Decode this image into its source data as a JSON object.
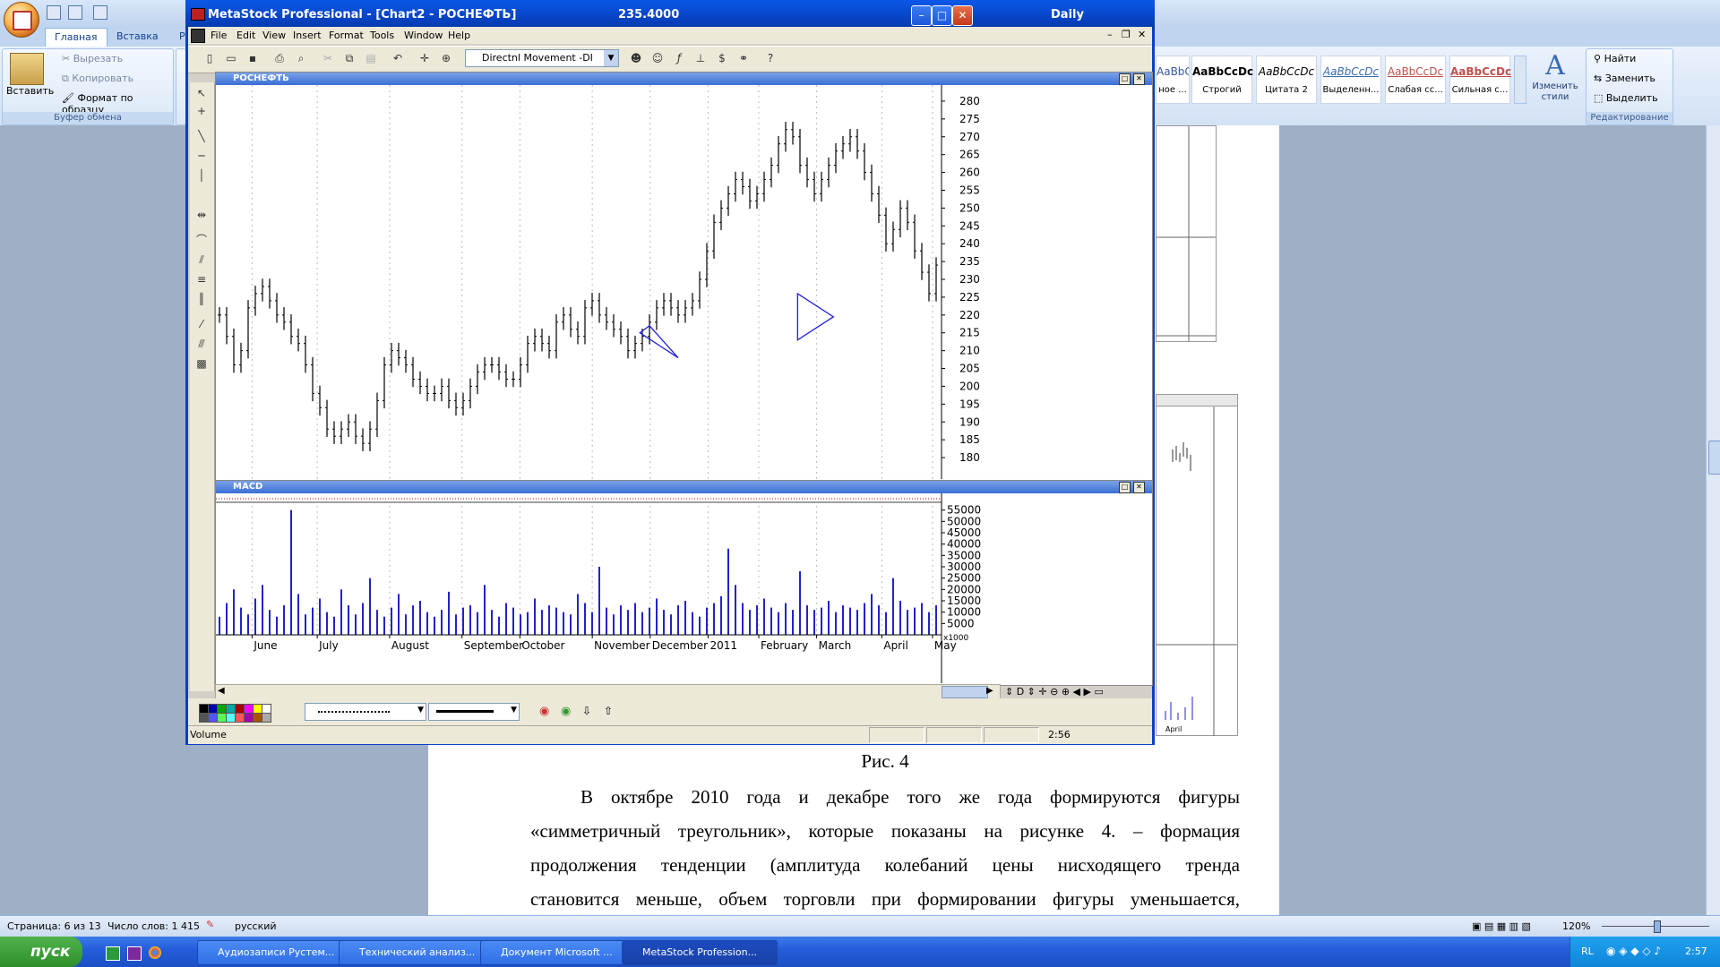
{
  "word": {
    "tabs": [
      "Главная",
      "Вставка",
      "Р"
    ],
    "clipboard": {
      "paste": "Вставить",
      "cut": "Вырезать",
      "copy": "Копировать",
      "format_painter": "Формат по образцу",
      "group_label": "Буфер обмена"
    },
    "styles": [
      {
        "sample": "AaBbCcDc",
        "name": "ное ..."
      },
      {
        "sample": "AaBbCcDc",
        "name": "Строгий"
      },
      {
        "sample": "AaBbCcDc",
        "name": "Цитата 2"
      },
      {
        "sample": "AaBbCcDc",
        "name": "Выделенн..."
      },
      {
        "sample": "AaBbCcDc",
        "name": "Слабая сс..."
      },
      {
        "sample": "AaBbCcDc",
        "name": "Сильная с..."
      }
    ],
    "change_styles": "Изменить стили",
    "editing": {
      "find": "Найти",
      "replace": "Заменить",
      "select": "Выделить",
      "group_label": "Редактирование"
    },
    "doc": {
      "caption": "Рис. 4",
      "lines": [
        "В октябре 2010 года и декабре того же года формируются фигуры",
        "«симметричный треугольник», которые показаны на рисунке 4. – формация",
        "продолжения тенденции (амплитуда колебаний цены нисходящего тренда",
        "становится меньше, объем торговли при формировании фигуры уменьшается,"
      ]
    },
    "status": {
      "page": "Страница: 6 из 13",
      "words": "Число слов: 1 415",
      "language": "русский",
      "zoom": "120%"
    },
    "bg_chart_labels": [
      "April"
    ]
  },
  "taskbar": {
    "start": "пуск",
    "items": [
      "Аудиозаписи Рустем...",
      "Технический анализ...",
      "Документ Microsoft ...",
      "MetaStock Profession..."
    ],
    "tray": {
      "lang": "RL",
      "time": "2:57"
    }
  },
  "metastock": {
    "title": "MetaStock Professional - [Chart2 - РОСНЕФТЬ]",
    "price_readout": "235.4000",
    "period": "Daily",
    "menu": [
      "File",
      "Edit",
      "View",
      "Insert",
      "Format",
      "Tools",
      "Window",
      "Help"
    ],
    "indicator_select": "Directnl Movement -DI",
    "price_pane_title": "РОСНЕФТЬ",
    "lower_pane_title": "MACD",
    "status_left": "Volume",
    "status_time": "2:56",
    "volume_unit": "x1000",
    "colors": {
      "title_blue": "#0a48d8",
      "bar_blue": "#2222cc",
      "triangle": "#2222dd"
    }
  },
  "chart_data": [
    {
      "type": "bar",
      "title": "РОСНЕФТЬ",
      "ylim": [
        176,
        283
      ],
      "yticks": [
        280,
        275,
        270,
        265,
        260,
        255,
        250,
        245,
        240,
        235,
        230,
        225,
        220,
        215,
        210,
        205,
        200,
        195,
        190,
        185,
        180
      ],
      "x_labels": [
        "June",
        "July",
        "August",
        "September",
        "October",
        "November",
        "December",
        "2011",
        "February",
        "March",
        "April",
        "May"
      ],
      "closes": [
        220,
        214,
        206,
        210,
        222,
        226,
        228,
        224,
        220,
        218,
        214,
        212,
        206,
        198,
        194,
        188,
        186,
        188,
        190,
        186,
        184,
        188,
        196,
        206,
        210,
        208,
        206,
        202,
        200,
        198,
        198,
        200,
        196,
        194,
        196,
        200,
        204,
        206,
        206,
        204,
        202,
        202,
        206,
        212,
        214,
        212,
        210,
        218,
        220,
        216,
        214,
        222,
        224,
        220,
        218,
        216,
        214,
        210,
        212,
        214,
        218,
        222,
        224,
        222,
        220,
        222,
        224,
        230,
        238,
        246,
        250,
        254,
        258,
        256,
        252,
        254,
        258,
        262,
        268,
        272,
        270,
        262,
        258,
        254,
        258,
        262,
        266,
        268,
        270,
        266,
        260,
        254,
        248,
        240,
        244,
        250,
        246,
        238,
        232,
        226,
        234
      ],
      "triangles": [
        {
          "from": [
            180,
            217
          ],
          "apex": [
            176,
            215
          ],
          "to": [
            192,
            208
          ]
        },
        {
          "from": [
            242,
            226
          ],
          "apex": [
            257,
            219.5
          ],
          "to": [
            242,
            213
          ]
        }
      ]
    },
    {
      "type": "bar",
      "title": "Volume",
      "unit": "x1000",
      "ylim": [
        0,
        60000
      ],
      "yticks": [
        55000,
        50000,
        45000,
        40000,
        35000,
        30000,
        25000,
        20000,
        15000,
        10000,
        5000
      ],
      "values": [
        8000,
        14000,
        20000,
        12000,
        9000,
        16000,
        22000,
        11000,
        8000,
        13000,
        55000,
        18000,
        9000,
        12000,
        16000,
        10000,
        8000,
        20000,
        13000,
        9000,
        14000,
        25000,
        11000,
        8000,
        12000,
        18000,
        9000,
        13000,
        15000,
        10000,
        8000,
        11000,
        19000,
        9000,
        12000,
        13000,
        10000,
        22000,
        11000,
        8000,
        14000,
        12000,
        9000,
        10000,
        16000,
        11000,
        13000,
        12000,
        10000,
        9000,
        18000,
        14000,
        10000,
        30000,
        12000,
        9000,
        13000,
        11000,
        14000,
        10000,
        12000,
        16000,
        11000,
        9000,
        13000,
        15000,
        10000,
        8000,
        12000,
        14000,
        17000,
        38000,
        22000,
        14000,
        11000,
        13000,
        16000,
        12000,
        10000,
        14000,
        11000,
        28000,
        13000,
        11000,
        12000,
        15000,
        10000,
        13000,
        12000,
        11000,
        14000,
        18000,
        13000,
        10000,
        25000,
        15000,
        11000,
        12000,
        14000,
        10000,
        13000
      ]
    }
  ]
}
